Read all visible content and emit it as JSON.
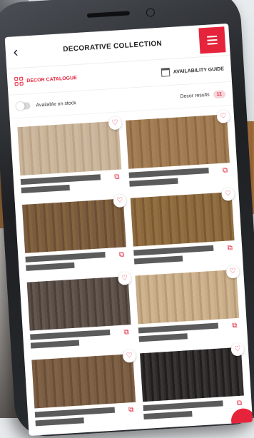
{
  "header": {
    "title": "DECORATIVE COLLECTION",
    "back_icon": "chevron-left-icon",
    "menu_icon": "hamburger-menu-icon"
  },
  "tabs": [
    {
      "label": "DECOR CATALOGUE",
      "icon": "grid-icon",
      "active": true
    },
    {
      "label": "AVAILABILITY GUIDE",
      "icon": "book-icon",
      "active": false
    }
  ],
  "filter": {
    "toggle_label": "Available on stock",
    "results_label": "Decor results",
    "results_count": "11"
  },
  "colors": {
    "accent": "#e5243b",
    "placeholder_text": "#5b5b5b"
  },
  "decors": [
    {
      "swatch": "wood-1"
    },
    {
      "swatch": "wood-2"
    },
    {
      "swatch": "wood-3"
    },
    {
      "swatch": "wood-4"
    },
    {
      "swatch": "wood-5"
    },
    {
      "swatch": "wood-6"
    },
    {
      "swatch": "wood-7"
    },
    {
      "swatch": "wood-8"
    }
  ]
}
